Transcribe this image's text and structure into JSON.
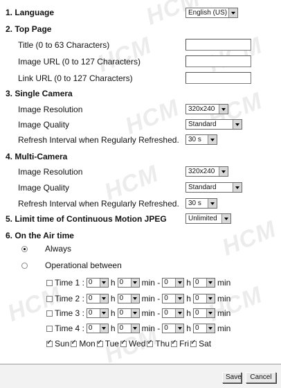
{
  "watermark": "HCM",
  "language": {
    "title": "1. Language",
    "value": "English (US)"
  },
  "top_page": {
    "title": "2. Top Page",
    "fields": [
      {
        "label": "Title (0 to 63 Characters)",
        "value": ""
      },
      {
        "label": "Image URL (0 to 127 Characters)",
        "value": ""
      },
      {
        "label": "Link URL (0 to 127 Characters)",
        "value": ""
      }
    ]
  },
  "single_camera": {
    "title": "3. Single Camera",
    "resolution_label": "Image Resolution",
    "resolution": "320x240",
    "quality_label": "Image Quality",
    "quality": "Standard",
    "refresh_label": "Refresh Interval when Regularly Refreshed.",
    "refresh": "30 s"
  },
  "multi_camera": {
    "title": "4. Multi-Camera",
    "resolution_label": "Image Resolution",
    "resolution": "320x240",
    "quality_label": "Image Quality",
    "quality": "Standard",
    "refresh_label": "Refresh Interval when Regularly Refreshed.",
    "refresh": "30 s"
  },
  "limit": {
    "title": "5. Limit time of Continuous Motion JPEG",
    "value": "Unlimited"
  },
  "on_air": {
    "title": "6. On the Air time",
    "always_label": "Always",
    "always_selected": true,
    "between_label": "Operational between",
    "h_label": "h",
    "min_label": "min",
    "dash_label": "min -",
    "zero": "0",
    "times": [
      {
        "label": "Time 1 :"
      },
      {
        "label": "Time 2 :"
      },
      {
        "label": "Time 3 :"
      },
      {
        "label": "Time 4 :"
      }
    ],
    "days": [
      "Sun",
      "Mon",
      "Tue",
      "Wed",
      "Thu",
      "Fri",
      "Sat"
    ]
  },
  "buttons": {
    "save": "Save",
    "cancel": "Cancel"
  }
}
